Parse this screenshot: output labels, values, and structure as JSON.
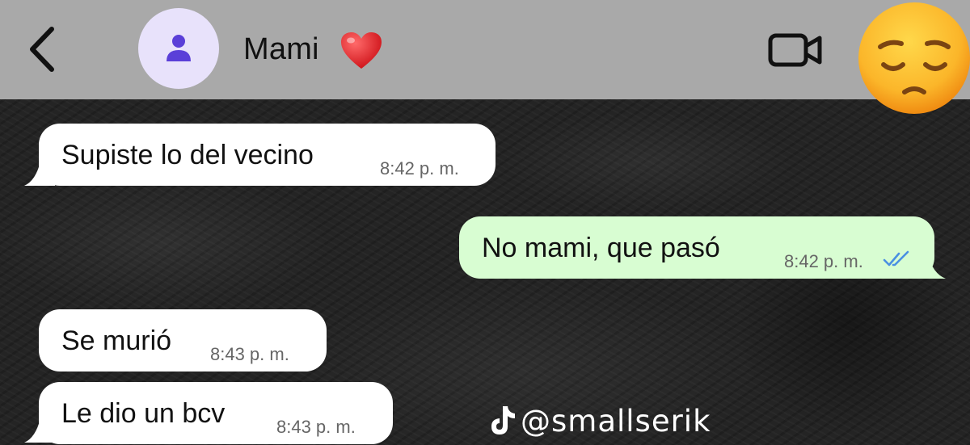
{
  "header": {
    "contact_name": "Mami",
    "contact_emoji": "heart-emoji"
  },
  "messages": [
    {
      "direction": "in",
      "text": "Supiste lo del vecino",
      "time": "8:42 p. m."
    },
    {
      "direction": "out",
      "text": "No mami, que pasó",
      "time": "8:42 p. m.",
      "status": "read"
    },
    {
      "direction": "in",
      "text": "Se murió",
      "time": "8:43 p. m."
    },
    {
      "direction": "in",
      "text": "Le dio un bcv",
      "time": "8:43 p. m."
    }
  ],
  "overlay": {
    "reaction_emoji": "pensive-face-emoji",
    "watermark": "@smallserik"
  },
  "colors": {
    "header_bg": "#a9a9a9",
    "incoming_bubble": "#ffffff",
    "outgoing_bubble": "#d8fdd2",
    "read_ticks": "#4a90e2",
    "avatar_bg": "#e8e2fb",
    "avatar_icon": "#5a3fd8"
  }
}
